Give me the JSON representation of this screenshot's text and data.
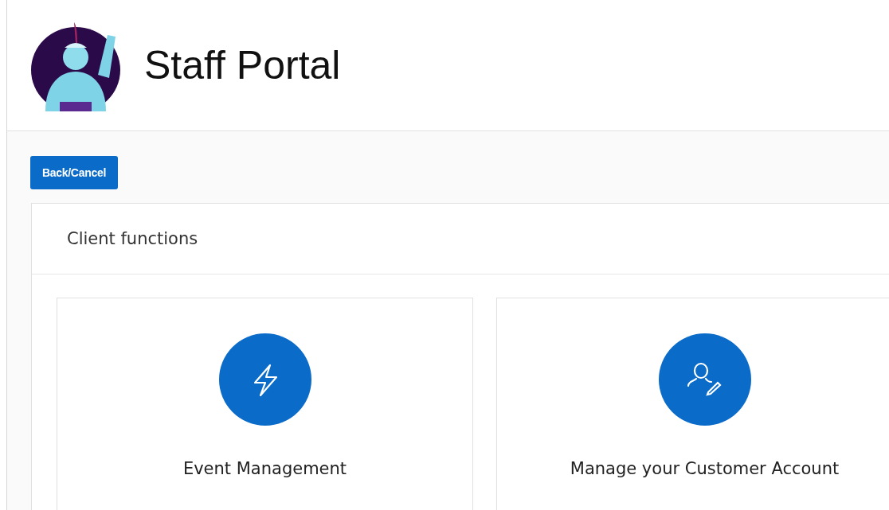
{
  "header": {
    "title": "Staff Portal"
  },
  "back_button": {
    "label": "Back/Cancel"
  },
  "panel": {
    "title": "Client functions",
    "cards": [
      {
        "kind": "lightning",
        "label": "Event Management"
      },
      {
        "kind": "account",
        "label": "Manage your Customer Account"
      }
    ]
  }
}
